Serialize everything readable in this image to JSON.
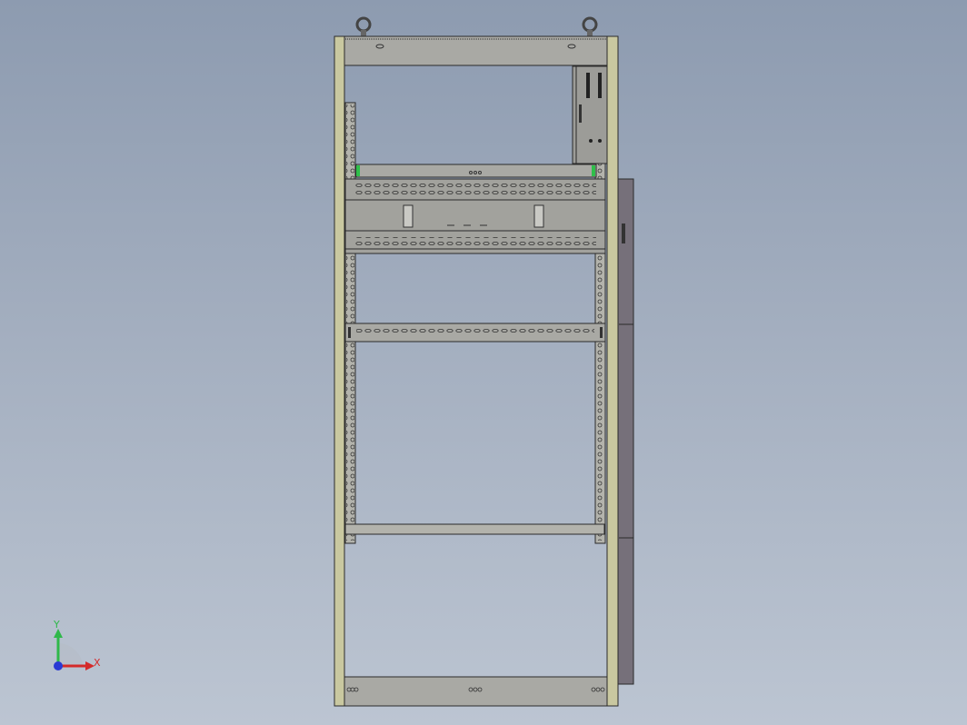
{
  "viewport": {
    "background_top": "#8d9bb0",
    "background_bottom": "#bcc5d2"
  },
  "model": {
    "frame_color": "#c9c8a0",
    "panel_color": "#a9a9a4",
    "side_door_color": "#76707a",
    "accent_green": "#2fbf4a",
    "edge_color": "#2a2a2a"
  },
  "triad": {
    "x_label": "X",
    "y_label": "Y",
    "x_color": "#d42a2a",
    "y_color": "#2fb84a",
    "z_color": "#2a3ad4"
  }
}
